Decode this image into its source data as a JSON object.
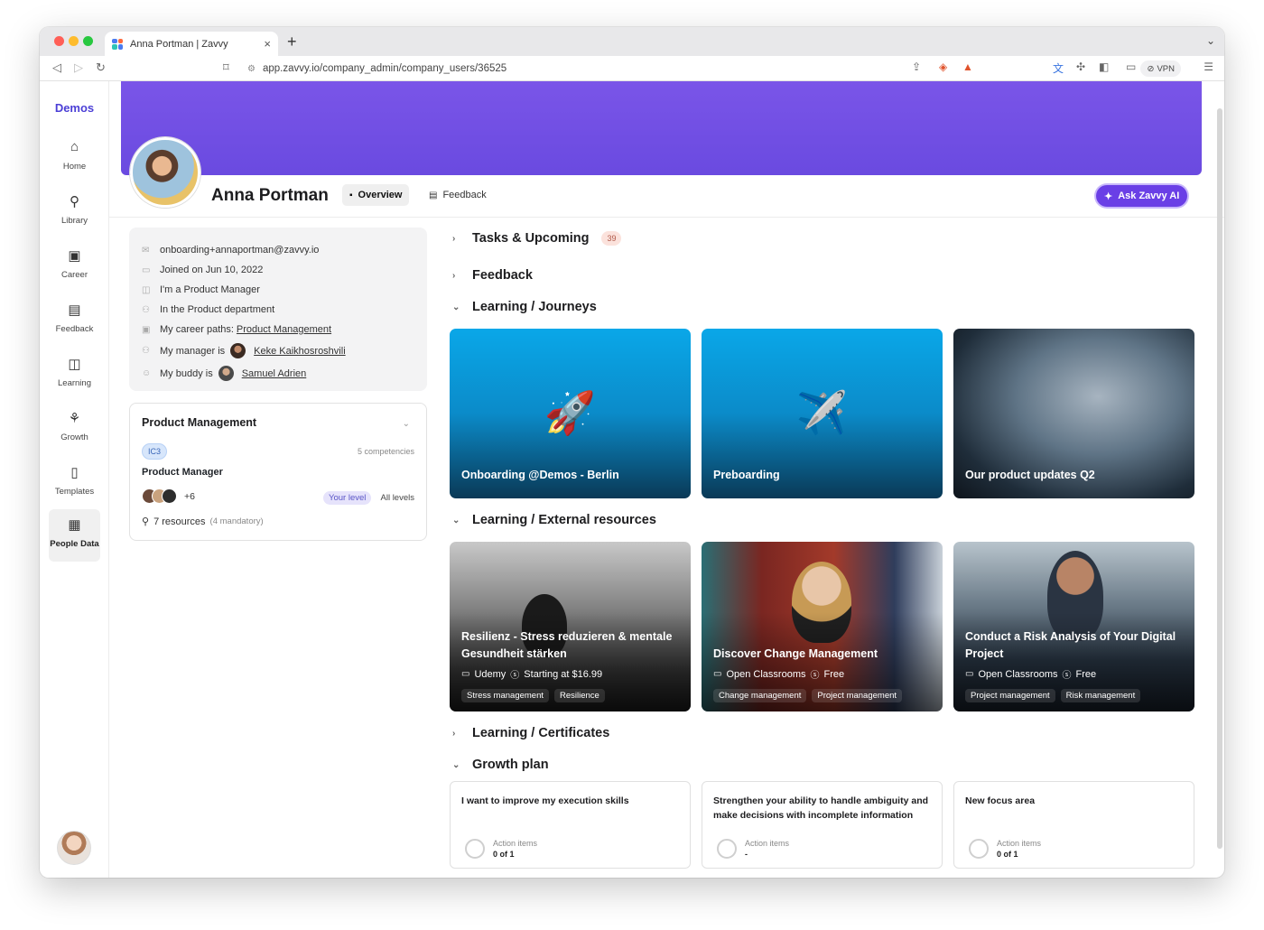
{
  "browser": {
    "tab_title": "Anna Portman | Zavvy",
    "url": "app.zavvy.io/company_admin/company_users/36525",
    "vpn_label": "VPN"
  },
  "sidebar": {
    "brand": "Demos",
    "items": [
      {
        "label": "Home",
        "icon": "home-icon"
      },
      {
        "label": "Library",
        "icon": "library-icon"
      },
      {
        "label": "Career",
        "icon": "career-icon"
      },
      {
        "label": "Feedback",
        "icon": "feedback-icon"
      },
      {
        "label": "Learning",
        "icon": "learning-icon"
      },
      {
        "label": "Growth",
        "icon": "growth-icon"
      },
      {
        "label": "Templates",
        "icon": "templates-icon"
      },
      {
        "label": "People Data",
        "icon": "people-data-icon"
      }
    ]
  },
  "profile": {
    "name": "Anna Portman",
    "tabs": [
      "Overview",
      "Feedback"
    ],
    "ask_ai": "Ask Zavvy AI"
  },
  "info": {
    "email": "onboarding+annaportman@zavvy.io",
    "joined": "Joined on Jun 10, 2022",
    "role": "I'm a Product Manager",
    "department": "In the Product department",
    "career_paths_label": "My career paths:",
    "career_path": "Product Management",
    "manager_label": "My manager is",
    "manager": "Keke Kaikhosroshvili",
    "buddy_label": "My buddy is",
    "buddy": "Samuel Adrien"
  },
  "career_card": {
    "title": "Product Management",
    "level_badge": "IC3",
    "competencies": "5 competencies",
    "role": "Product Manager",
    "more_people": "+6",
    "your_level": "Your level",
    "all_levels": "All levels",
    "resources": "7 resources",
    "mandatory": "(4 mandatory)"
  },
  "sections": {
    "tasks": "Tasks & Upcoming",
    "tasks_count": "39",
    "feedback": "Feedback",
    "journeys": "Learning / Journeys",
    "external": "Learning / External resources",
    "certificates": "Learning / Certificates",
    "growth": "Growth plan"
  },
  "journeys": [
    {
      "title": "Onboarding @Demos - Berlin",
      "icon": "rocket-icon"
    },
    {
      "title": "Preboarding",
      "icon": "airplane-icon"
    },
    {
      "title": "Our product updates Q2",
      "icon": "earth-image"
    }
  ],
  "external": [
    {
      "title": "Resilienz - Stress reduzieren & mentale Gesundheit stärken",
      "provider": "Udemy",
      "price": "Starting at $16.99",
      "tags": [
        "Stress management",
        "Resilience"
      ]
    },
    {
      "title": "Discover Change Management",
      "provider": "Open Classrooms",
      "price": "Free",
      "tags": [
        "Change management",
        "Project management"
      ]
    },
    {
      "title": "Conduct a Risk Analysis of Your Digital Project",
      "provider": "Open Classrooms",
      "price": "Free",
      "tags": [
        "Project management",
        "Risk management"
      ]
    }
  ],
  "goals": [
    {
      "title": "I want to improve my execution skills",
      "label": "Action items",
      "value": "0 of 1"
    },
    {
      "title": "Strengthen your ability to handle ambiguity and make decisions with incomplete information",
      "label": "Action items",
      "value": "-"
    },
    {
      "title": "New focus area",
      "label": "Action items",
      "value": "0 of 1"
    }
  ],
  "colors": {
    "accent": "#6a3fe6",
    "banner": "#7a55e8"
  }
}
